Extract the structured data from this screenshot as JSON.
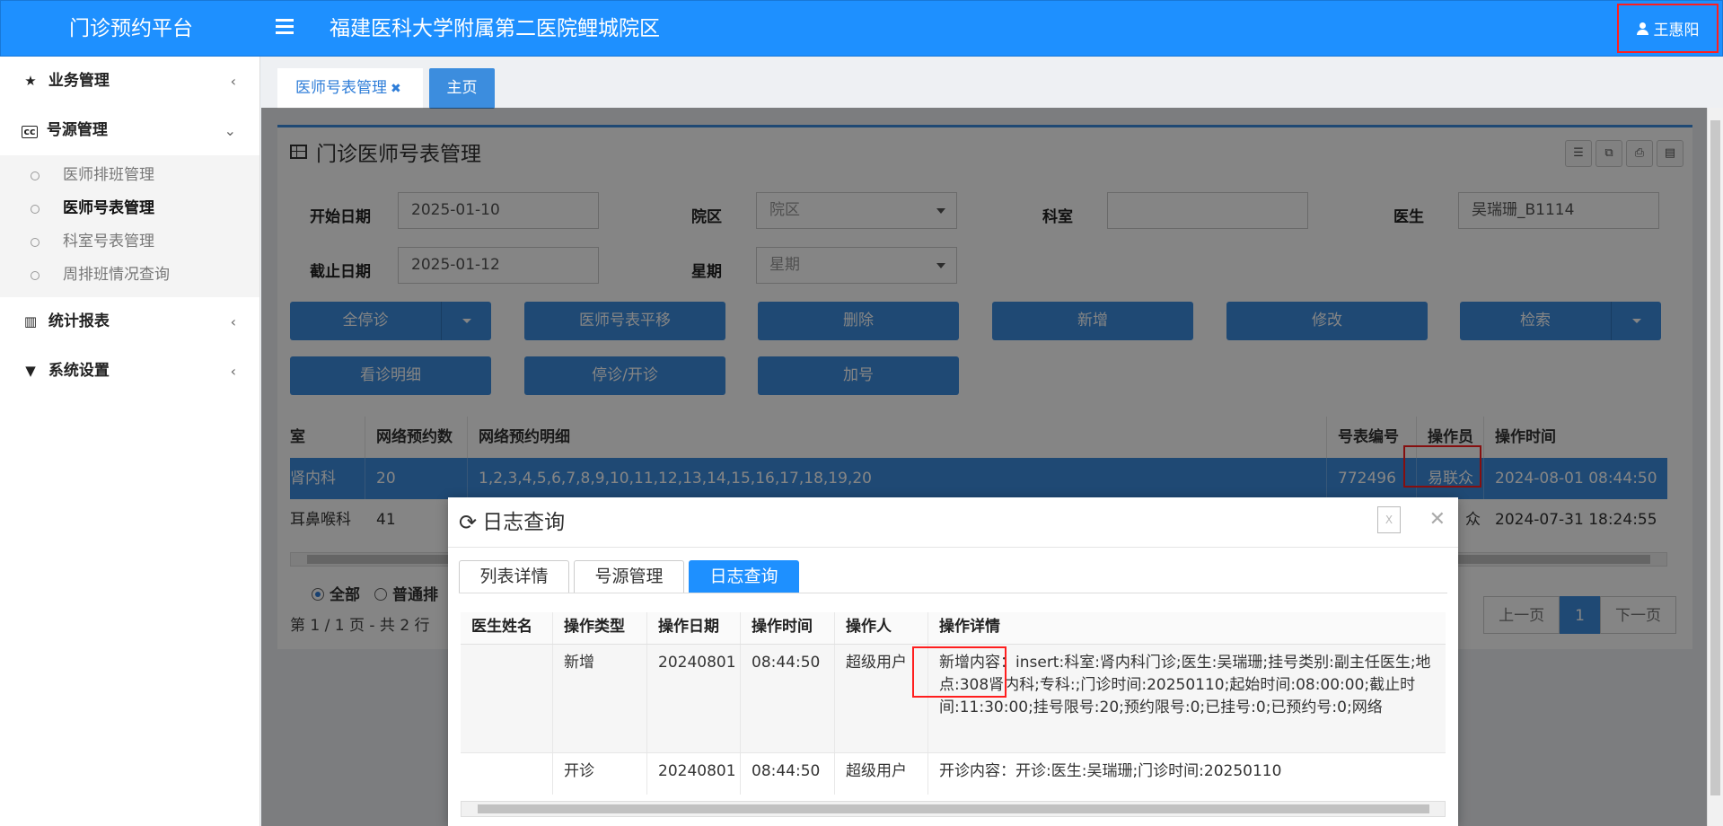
{
  "topbar": {
    "brand": "门诊预约平台",
    "hospital": "福建医科大学附属第二医院鲤城院区",
    "user": "王惠阳"
  },
  "sidebar": {
    "sections": [
      {
        "label": "业务管理",
        "icon": "star-icon"
      },
      {
        "label": "号源管理",
        "icon": "cc-icon"
      },
      {
        "label": "统计报表",
        "icon": "bar-chart-icon"
      },
      {
        "label": "系统设置",
        "icon": "filter-icon"
      }
    ],
    "subitems": [
      "医师排班管理",
      "医师号表管理",
      "科室号表管理",
      "周排班情况查询"
    ]
  },
  "tabs": {
    "doc": "医师号表管理",
    "home": "主页"
  },
  "panel": {
    "title": "门诊医师号表管理"
  },
  "filters": {
    "start_label": "开始日期",
    "start_value": "2025-01-10",
    "campus_label": "院区",
    "campus_value": "院区",
    "dept_label": "科室",
    "dept_value": "",
    "doctor_label": "医生",
    "doctor_value": "吴瑞珊_B1114",
    "end_label": "截止日期",
    "end_value": "2025-01-12",
    "week_label": "星期",
    "week_value": "星期"
  },
  "buttons": {
    "stop_all": "全停诊",
    "shift": "医师号表平移",
    "delete": "删除",
    "add": "新增",
    "edit": "修改",
    "search": "检索",
    "detail": "看诊明细",
    "toggle": "停诊/开诊",
    "extra": "加号"
  },
  "grid": {
    "headers": [
      "室",
      "网络预约数",
      "网络预约明细",
      "号表编号",
      "操作员",
      "操作时间"
    ],
    "rows": [
      [
        "肾内科",
        "20",
        "1,2,3,4,5,6,7,8,9,10,11,12,13,14,15,16,17,18,19,20",
        "772496",
        "易联众",
        "2024-08-01 08:44:50"
      ],
      [
        "耳鼻喉科",
        "41",
        "",
        "",
        "众",
        "2024-07-31 18:24:55"
      ]
    ]
  },
  "filter_radios": {
    "all": "全部",
    "normal": "普通排"
  },
  "pagination": {
    "info": "第 1 / 1 页 - 共 2 行",
    "prev": "上一页",
    "current": "1",
    "next": "下一页"
  },
  "modal": {
    "title": "日志查询",
    "tabs": [
      "列表详情",
      "号源管理",
      "日志查询"
    ],
    "headers": [
      "医生姓名",
      "操作类型",
      "操作日期",
      "操作时间",
      "操作人",
      "操作详情"
    ],
    "rows": [
      [
        "",
        "新增",
        "20240801",
        "08:44:50",
        "超级用户",
        "新增内容：insert:科室:肾内科门诊;医生:吴瑞珊;挂号类别:副主任医生;地点:308肾内科;专科:;门诊时间:20250110;起始时间:08:00:00;截止时间:11:30:00;挂号限号:20;预约限号:0;已挂号:0;已预约号:0;网络"
      ],
      [
        "",
        "开诊",
        "20240801",
        "08:44:50",
        "超级用户",
        "开诊内容：开诊:医生:吴瑞珊;门诊时间:20250110"
      ]
    ]
  }
}
